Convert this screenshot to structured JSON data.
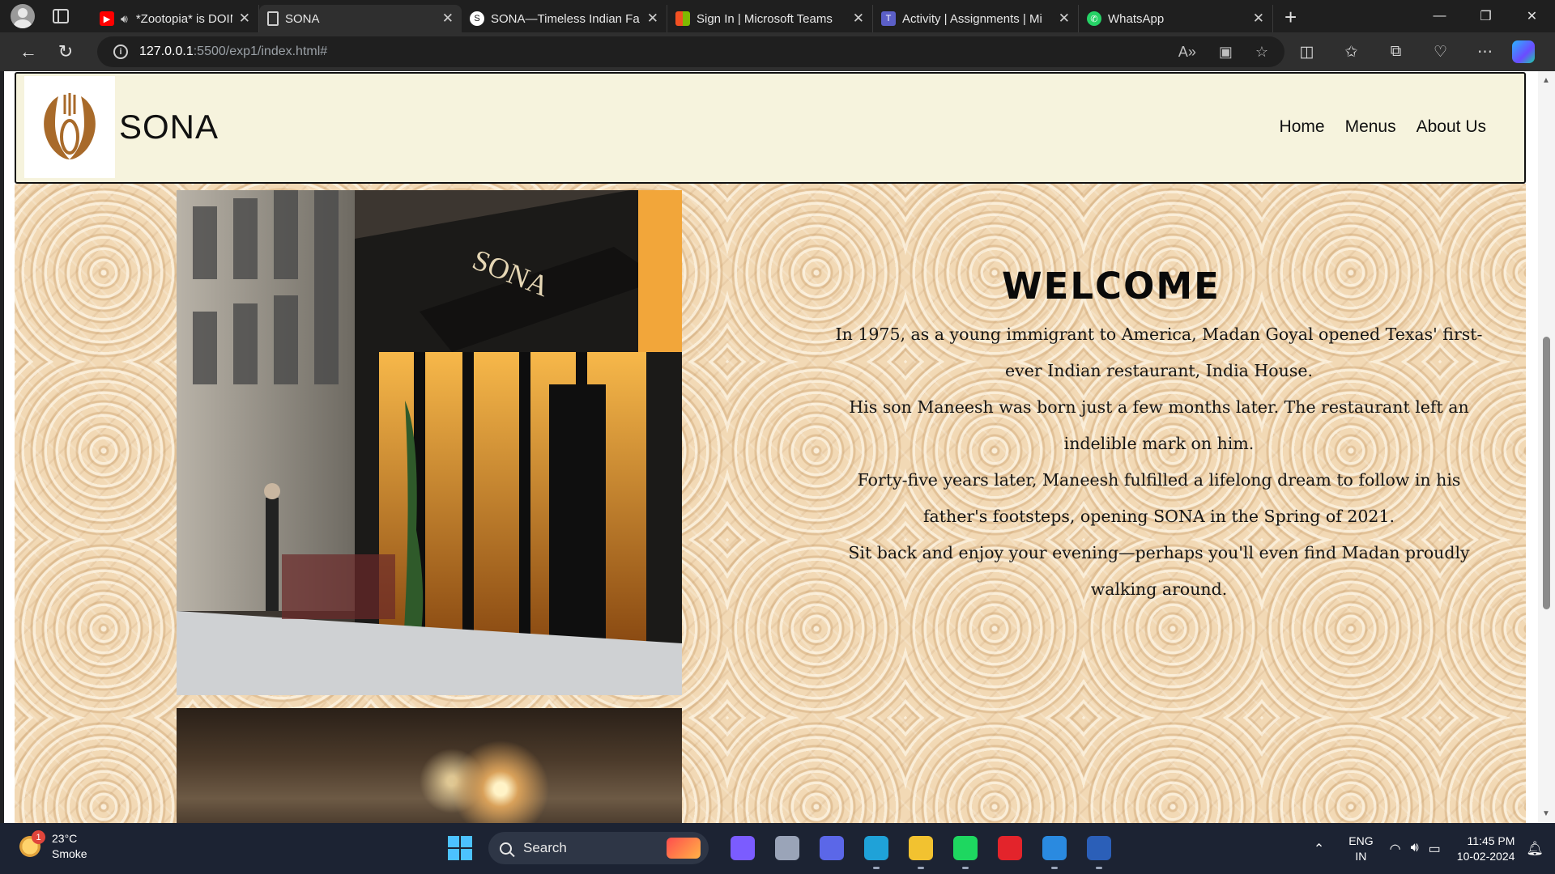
{
  "browser": {
    "tabs": [
      {
        "title": "*Zootopia* is DOING",
        "favicon": "youtube-icon",
        "audio": true,
        "active": false
      },
      {
        "title": "SONA",
        "favicon": "page-icon",
        "active": true
      },
      {
        "title": "SONA—Timeless Indian Fa",
        "favicon": "sona-icon",
        "active": false
      },
      {
        "title": "Sign In | Microsoft Teams",
        "favicon": "microsoft-icon",
        "active": false
      },
      {
        "title": "Activity | Assignments | Mi",
        "favicon": "teams-icon",
        "active": false
      },
      {
        "title": "WhatsApp",
        "favicon": "whatsapp-icon",
        "active": false
      }
    ],
    "address": {
      "host": "127.0.0.1",
      "path": ":5500/exp1/index.html#"
    }
  },
  "site": {
    "brand": "SONA",
    "nav": [
      {
        "label": "Home"
      },
      {
        "label": "Menus"
      },
      {
        "label": "About Us"
      }
    ],
    "welcome_title": "WELCOME",
    "story": [
      "In 1975, as a young immigrant to America, Madan Goyal opened Texas' first-ever Indian restaurant, India House.",
      "His son Maneesh was born just a few months later. The restaurant left an indelible mark on him.",
      "Forty-five years later, Maneesh fulfilled a lifelong dream to follow in his father's footsteps, opening SONA in the Spring of 2021.",
      "Sit back and enjoy your evening—perhaps you'll even find Madan proudly walking around."
    ],
    "storefront_sign": "SONA"
  },
  "taskbar": {
    "weather": {
      "temp": "23°C",
      "condition": "Smoke",
      "badge": "1"
    },
    "search_label": "Search",
    "apps": [
      {
        "name": "copilot-app",
        "color": "#7b5cff",
        "active": false
      },
      {
        "name": "task-view-app",
        "color": "#9aa4b8",
        "active": false
      },
      {
        "name": "meet-app",
        "color": "#5b67e8",
        "active": false
      },
      {
        "name": "edge-app",
        "color": "#1fa2d8",
        "active": true
      },
      {
        "name": "file-explorer-app",
        "color": "#f2c230",
        "active": true
      },
      {
        "name": "spotify-app",
        "color": "#1ed760",
        "active": true
      },
      {
        "name": "opera-app",
        "color": "#e3242b",
        "active": false
      },
      {
        "name": "vscode-app",
        "color": "#2a8ae0",
        "active": true
      },
      {
        "name": "word-app",
        "color": "#2b5fb8",
        "active": true
      }
    ],
    "lang": [
      "ENG",
      "IN"
    ],
    "time": "11:45 PM",
    "date": "10-02-2024"
  }
}
